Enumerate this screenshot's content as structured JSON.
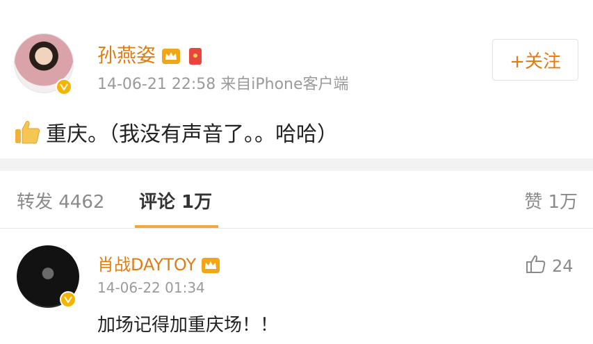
{
  "post": {
    "author": "孙燕姿",
    "time": "14-06-21 22:58",
    "source": "来自iPhone客户端",
    "follow_label": "+关注",
    "text": "重庆。（我没有声音了。。哈哈）",
    "icons": [
      "vip-crown-icon",
      "red-packet-icon",
      "verified-badge-icon",
      "thumbs-up-emoji"
    ]
  },
  "tabs": {
    "repost": "转发 4462",
    "comment": "评论 1万",
    "like": "赞 1万"
  },
  "comment": {
    "author": "肖战DAYTOY",
    "time": "14-06-22 01:34",
    "text": "加场记得加重庆场！！",
    "like_count": "24",
    "icons": [
      "vip-crown-icon",
      "verified-badge-icon",
      "like-icon"
    ]
  },
  "colors": {
    "accent": "#e07c14",
    "badge": "#f4b400",
    "tab_underline": "#f4a83c"
  }
}
